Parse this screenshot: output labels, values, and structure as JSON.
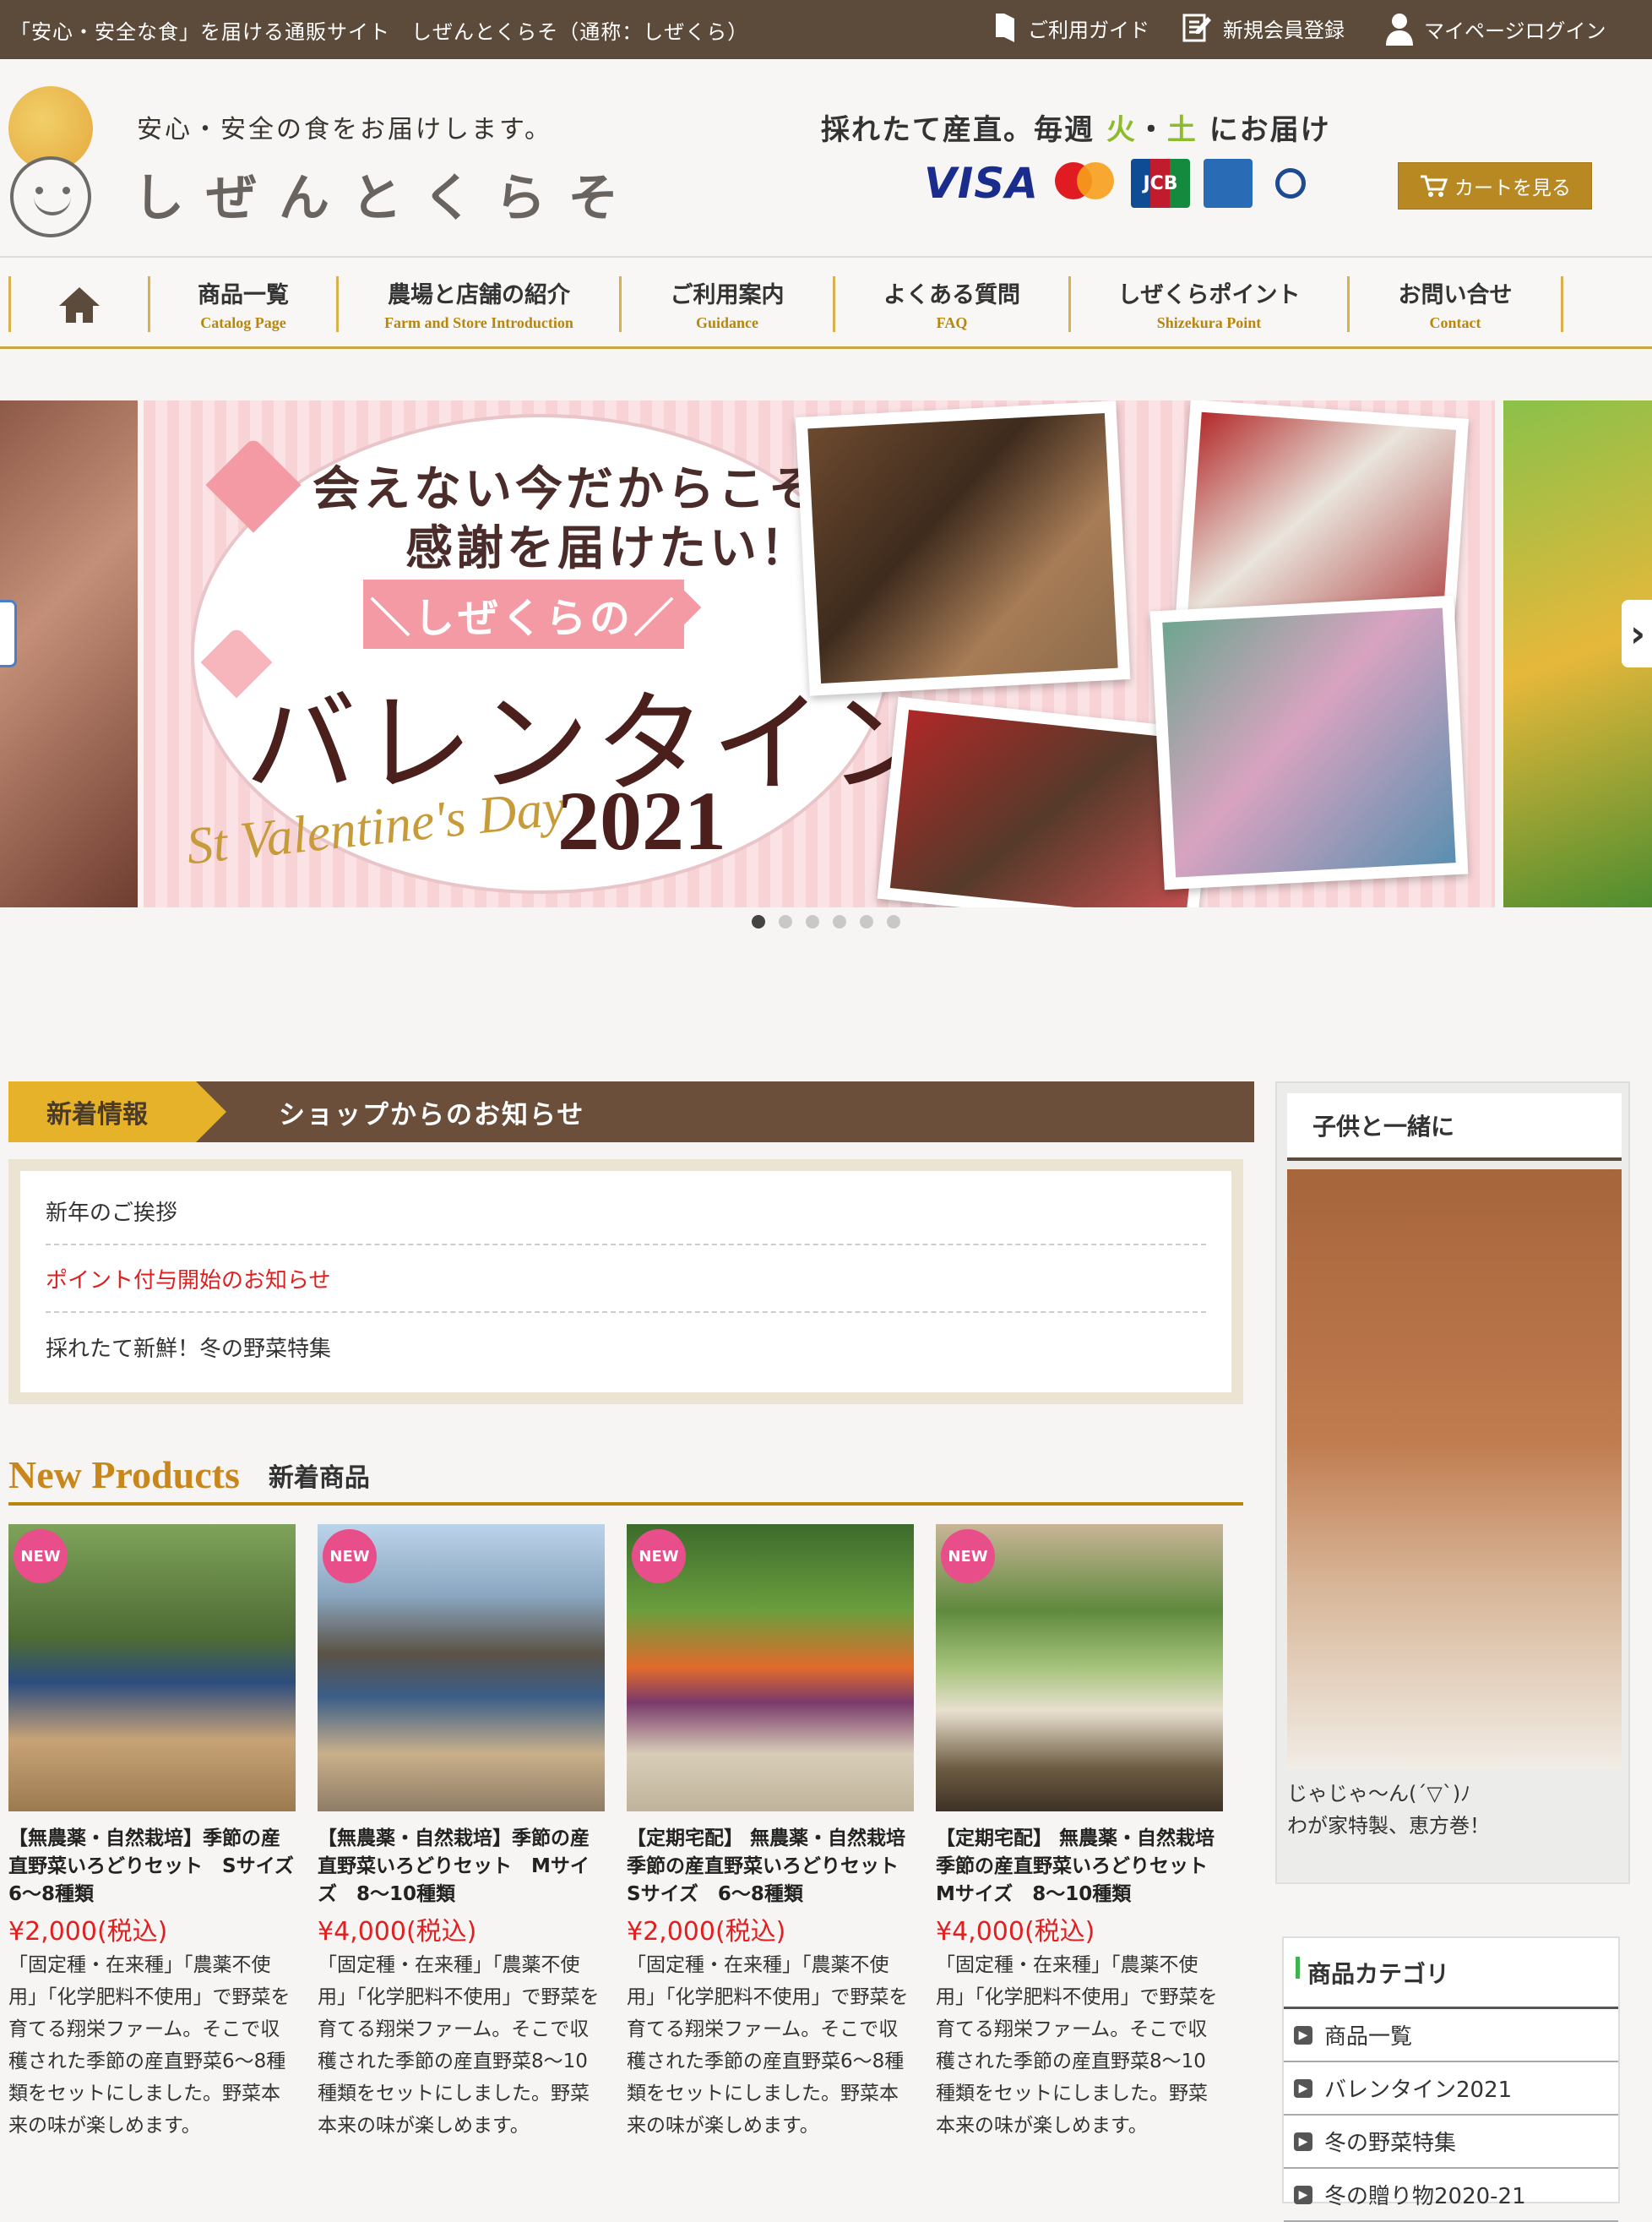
{
  "topbar": {
    "tagline": "「安心・安全な食」を届ける通販サイト　しぜんとくらそ（通称：しぜくら）",
    "guide": "ご利用ガイド",
    "register": "新規会員登録",
    "login": "マイページログイン"
  },
  "header": {
    "slogan": "安心・安全の食をお届けします。",
    "brand": "しぜんとくらそ",
    "delivery_prefix": "採れたて産直。毎週",
    "day1": "火",
    "dot": "・",
    "day2": "土",
    "delivery_suffix": "にお届け",
    "cards": [
      "VISA",
      "mastercard",
      "JCB",
      "AMERICAN EXPRESS",
      "Diners Club International"
    ],
    "cart_label": "カートを見る"
  },
  "nav": [
    {
      "jp": "商品一覧",
      "en": "Catalog Page"
    },
    {
      "jp": "農場と店舗の紹介",
      "en": "Farm and Store Introduction"
    },
    {
      "jp": "ご利用案内",
      "en": "Guidance"
    },
    {
      "jp": "よくある質問",
      "en": "FAQ"
    },
    {
      "jp": "しぜくらポイント",
      "en": "Shizekura Point"
    },
    {
      "jp": "お問い合せ",
      "en": "Contact"
    }
  ],
  "banner": {
    "line1": "会えない今だからこそ、",
    "line2": "感謝を届けたい！",
    "ribbon": "＼しぜくらの／",
    "title": "バレンタイン",
    "script": "St Valentine's Day",
    "year": "2021",
    "dots": 6,
    "active_dot": 0
  },
  "news": {
    "tag": "新着情報",
    "title": "ショップからのお知らせ",
    "items": [
      "新年のご挨拶",
      "ポイント付与開始のお知らせ",
      "採れたて新鮮！冬の野菜特集"
    ]
  },
  "new_products": {
    "en": "New Products",
    "jp": "新着商品",
    "badge": "NEW",
    "items": [
      {
        "name": "【無農薬・自然栽培】季節の産直野菜いろどりセット　Sサイズ　6〜8種類",
        "price": "¥2,000(税込)",
        "desc": "「固定種・在来種」「農薬不使用」「化学肥料不使用」で野菜を育てる翔栄ファーム。そこで収穫された季節の産直野菜6〜8種類をセットにしました。野菜本来の味が楽しめます。"
      },
      {
        "name": "【無農薬・自然栽培】季節の産直野菜いろどりセット　Mサイズ　8〜10種類",
        "price": "¥4,000(税込)",
        "desc": "「固定種・在来種」「農薬不使用」「化学肥料不使用」で野菜を育てる翔栄ファーム。そこで収穫された季節の産直野菜8〜10種類をセットにしました。野菜本来の味が楽しめます。"
      },
      {
        "name": "【定期宅配】 無農薬・自然栽培 季節の産直野菜いろどりセット　Sサイズ　6〜8種類",
        "price": "¥2,000(税込)",
        "desc": "「固定種・在来種」「農薬不使用」「化学肥料不使用」で野菜を育てる翔栄ファーム。そこで収穫された季節の産直野菜6〜8種類をセットにしました。野菜本来の味が楽しめます。"
      },
      {
        "name": "【定期宅配】 無農薬・自然栽培 季節の産直野菜いろどりセット　Mサイズ　8〜10種類",
        "price": "¥4,000(税込)",
        "desc": "「固定種・在来種」「農薬不使用」「化学肥料不使用」で野菜を育てる翔栄ファーム。そこで収穫された季節の産直野菜8〜10種類をセットにしました。野菜本来の味が楽しめます。"
      }
    ]
  },
  "sidebar": {
    "feature_title": "子供と一緒に",
    "feature_caption1": "じゃじゃ〜ん(´▽`)ﾉ",
    "feature_caption2": "わが家特製、恵方巻！",
    "category_title": "商品カテゴリ",
    "categories": [
      "商品一覧",
      "バレンタイン2021",
      "冬の野菜特集",
      "冬の贈り物2020-21"
    ]
  }
}
